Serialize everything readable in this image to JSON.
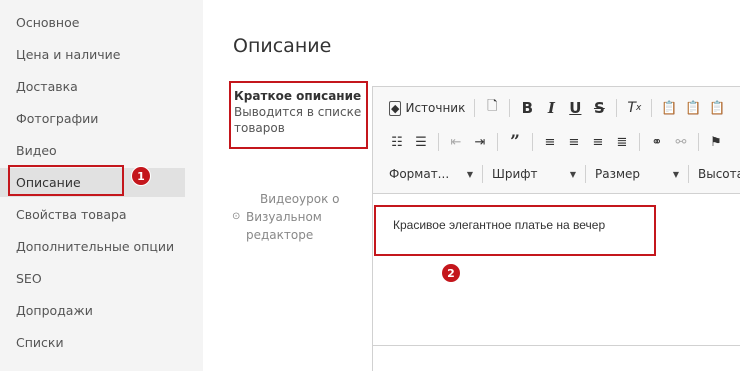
{
  "sidebar": {
    "items": [
      {
        "label": "Основное"
      },
      {
        "label": "Цена и наличие"
      },
      {
        "label": "Доставка"
      },
      {
        "label": "Фотографии"
      },
      {
        "label": "Видео"
      },
      {
        "label": "Описание"
      },
      {
        "label": "Свойства товара"
      },
      {
        "label": "Дополнительные опции"
      },
      {
        "label": "SEO"
      },
      {
        "label": "Допродажи"
      },
      {
        "label": "Списки"
      }
    ]
  },
  "main": {
    "title": "Описание",
    "field": {
      "label": "Краткое описание",
      "hint": "Выводится в списке товаров"
    },
    "video_hint": {
      "line1": "Видеоурок о",
      "line2": "Визуальном",
      "line3": "редакторе"
    }
  },
  "editor": {
    "source_label": "Источник",
    "format_label": "Формат...",
    "font_label": "Шрифт",
    "size_label": "Размер",
    "height_label": "Высота ...",
    "content": "Красивое элегантное платье на вечер"
  },
  "annotations": {
    "badge1": "1",
    "badge2": "2"
  },
  "colors": {
    "highlight": "#c4161c",
    "sidebar_bg": "#f4f4f4",
    "active_item": "#e1e1e1"
  }
}
